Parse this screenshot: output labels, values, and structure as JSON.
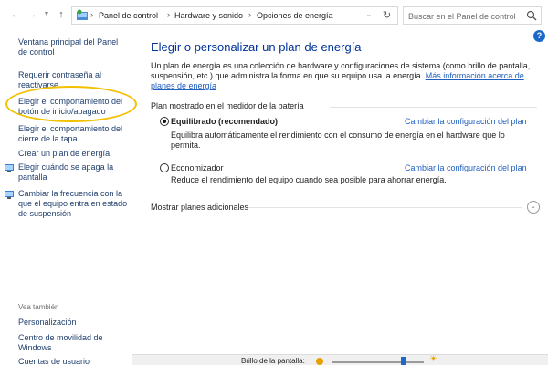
{
  "addressbar": {
    "breadcrumbs": [
      "Panel de control",
      "Hardware y sonido",
      "Opciones de energía"
    ],
    "search_placeholder": "Buscar en el Panel de control"
  },
  "sidebar": {
    "links": [
      "Ventana principal del Panel de control",
      "Requerir contraseña al reactivarse",
      "Elegir el comportamiento del botón de inicio/apagado",
      "Elegir el comportamiento del cierre de la tapa",
      "Crear un plan de energía",
      "Elegir cuándo se apaga la pantalla",
      "Cambiar la frecuencia con la que el equipo entra en estado de suspensión"
    ],
    "see_also_heading": "Vea también",
    "see_also_links": [
      "Personalización",
      "Centro de movilidad de Windows",
      "Cuentas de usuario"
    ]
  },
  "main": {
    "title": "Elegir o personalizar un plan de energía",
    "intro_text": "Un plan de energía es una colección de hardware y configuraciones de sistema (como brillo de pantalla, suspensión, etc.) que administra la forma en que su equipo usa la energía.",
    "intro_link": "Más información acerca de planes de energía",
    "battery_section_label": "Plan mostrado en el medidor de la batería",
    "plans": [
      {
        "name": "Equilibrado (recomendado)",
        "selected": true,
        "description": "Equilibra automáticamente el rendimiento con el consumo de energía en el hardware que lo permita.",
        "change_link": "Cambiar la configuración del plan"
      },
      {
        "name": "Economizador",
        "selected": false,
        "description": "Reduce el rendimiento del equipo cuando sea posible para ahorrar energía.",
        "change_link": "Cambiar la configuración del plan"
      }
    ],
    "more_plans_label": "Mostrar planes adicionales"
  },
  "bottombar": {
    "brightness_label": "Brillo de la pantalla:",
    "brightness_level": 0.78
  },
  "colors": {
    "link": "#1f5fbf",
    "title": "#003399",
    "highlight": "#f2c100"
  }
}
